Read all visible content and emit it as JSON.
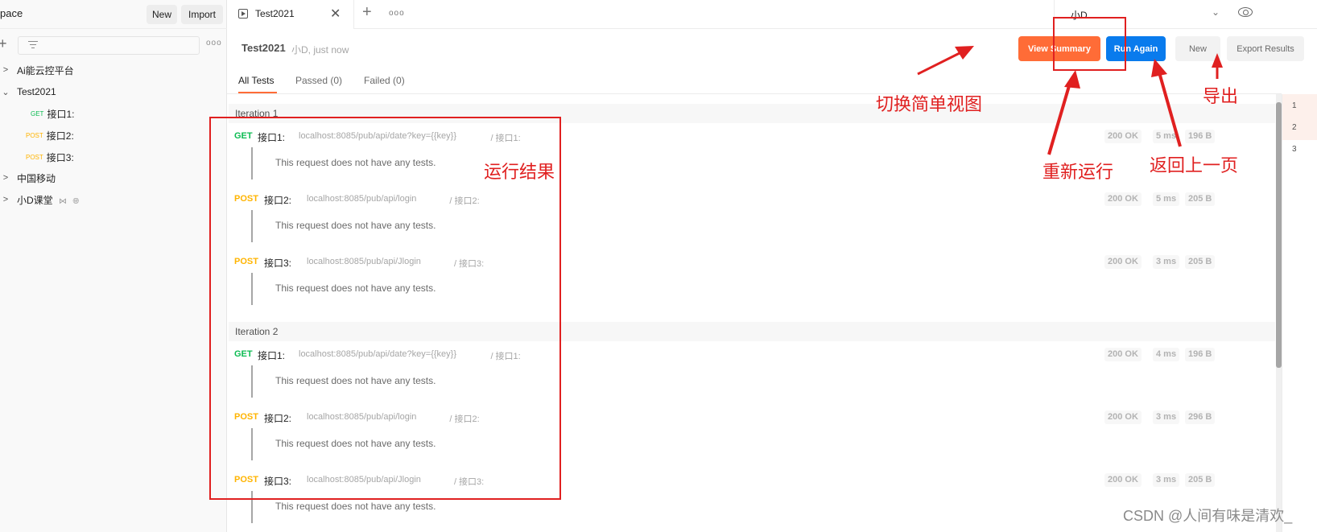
{
  "sidebar": {
    "workspace_title": "pace",
    "new_label": "New",
    "import_label": "Import",
    "collections": [
      {
        "name": "Ai能云控平台",
        "expanded": false
      },
      {
        "name": "Test2021",
        "expanded": true,
        "requests": [
          {
            "method": "GET",
            "name": "接口1:"
          },
          {
            "method": "POST",
            "name": "接口2:"
          },
          {
            "method": "POST",
            "name": "接口3:"
          }
        ]
      },
      {
        "name": "中国移动",
        "expanded": false
      },
      {
        "name": "小D课堂",
        "expanded": false,
        "icons": [
          "team-icon",
          "globe-icon"
        ]
      }
    ]
  },
  "tabs": {
    "active": "Test2021",
    "environment": "小D"
  },
  "runner": {
    "title": "Test2021",
    "meta": "小D, just now",
    "buttons": {
      "view_summary": "View Summary",
      "run_again": "Run Again",
      "new": "New",
      "export": "Export Results"
    },
    "filter_tabs": [
      "All Tests",
      "Passed (0)",
      "Failed (0)"
    ],
    "iterations": [
      {
        "label": "Iteration 1",
        "requests": [
          {
            "method": "GET",
            "name": "接口1:",
            "url": "localhost:8085/pub/api/date?key={{key}}",
            "path": "/ 接口1:",
            "status": "200 OK",
            "time": "5 ms",
            "size": "196 B",
            "tests": "This request does not have any tests."
          },
          {
            "method": "POST",
            "name": "接口2:",
            "url": "localhost:8085/pub/api/login",
            "path": "/ 接口2:",
            "status": "200 OK",
            "time": "5 ms",
            "size": "205 B",
            "tests": "This request does not have any tests."
          },
          {
            "method": "POST",
            "name": "接口3:",
            "url": "localhost:8085/pub/api/Jlogin",
            "path": "/ 接口3:",
            "status": "200 OK",
            "time": "3 ms",
            "size": "205 B",
            "tests": "This request does not have any tests."
          }
        ]
      },
      {
        "label": "Iteration 2",
        "requests": [
          {
            "method": "GET",
            "name": "接口1:",
            "url": "localhost:8085/pub/api/date?key={{key}}",
            "path": "/ 接口1:",
            "status": "200 OK",
            "time": "4 ms",
            "size": "196 B",
            "tests": "This request does not have any tests."
          },
          {
            "method": "POST",
            "name": "接口2:",
            "url": "localhost:8085/pub/api/login",
            "path": "/ 接口2:",
            "status": "200 OK",
            "time": "3 ms",
            "size": "296 B",
            "tests": "This request does not have any tests."
          },
          {
            "method": "POST",
            "name": "接口3:",
            "url": "localhost:8085/pub/api/Jlogin",
            "path": "/ 接口3:",
            "status": "200 OK",
            "time": "3 ms",
            "size": "205 B",
            "tests": "This request does not have any tests."
          }
        ]
      }
    ],
    "iteration_nav": [
      "1",
      "2",
      "3"
    ]
  },
  "annotations": {
    "switch_view": "切换简单视图",
    "results": "运行结果",
    "rerun": "重新运行",
    "back": "返回上一页",
    "export": "导出"
  },
  "watermark": "CSDN @人间有味是清欢_",
  "colors": {
    "accent": "#ff6c37",
    "primary": "#097bed",
    "get": "#0cbb52",
    "post": "#ffb400",
    "annotation": "#e02020"
  }
}
